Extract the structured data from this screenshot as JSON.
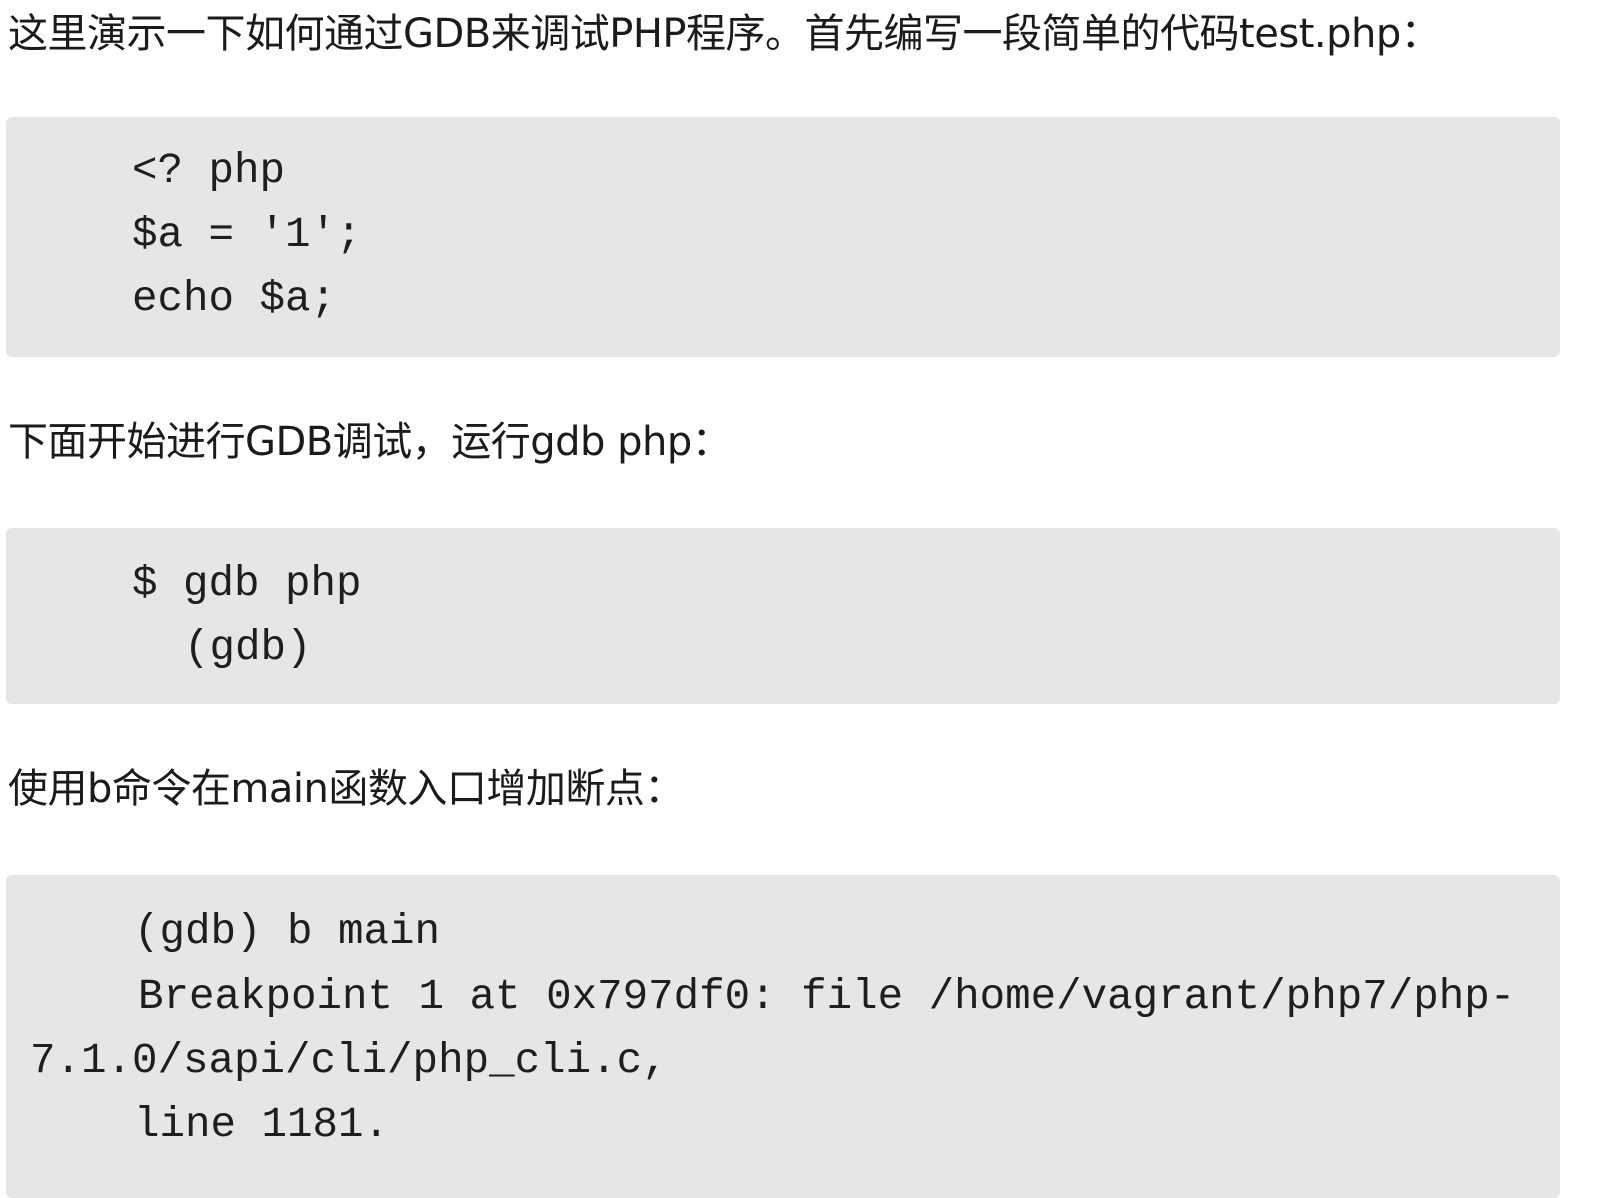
{
  "paragraphs": {
    "intro": "这里演示一下如何通过GDB来调试PHP程序。首先编写一段简单的代码test.php：",
    "run_gdb": "下面开始进行GDB调试，运行gdb php：",
    "breakpoint": "使用b命令在main函数入口增加断点："
  },
  "code_blocks": {
    "php_source": {
      "lines": [
        "<? php",
        "$a = '1';",
        "echo $a;"
      ]
    },
    "gdb_start": {
      "lines": [
        "$ gdb php",
        "(gdb)"
      ]
    },
    "gdb_break": {
      "lines": [
        "(gdb) b main",
        "Breakpoint 1 at 0x797df0: file /home/vagrant/php7/php-",
        "7.1.0/sapi/cli/php_cli.c,",
        "line 1181."
      ]
    }
  }
}
